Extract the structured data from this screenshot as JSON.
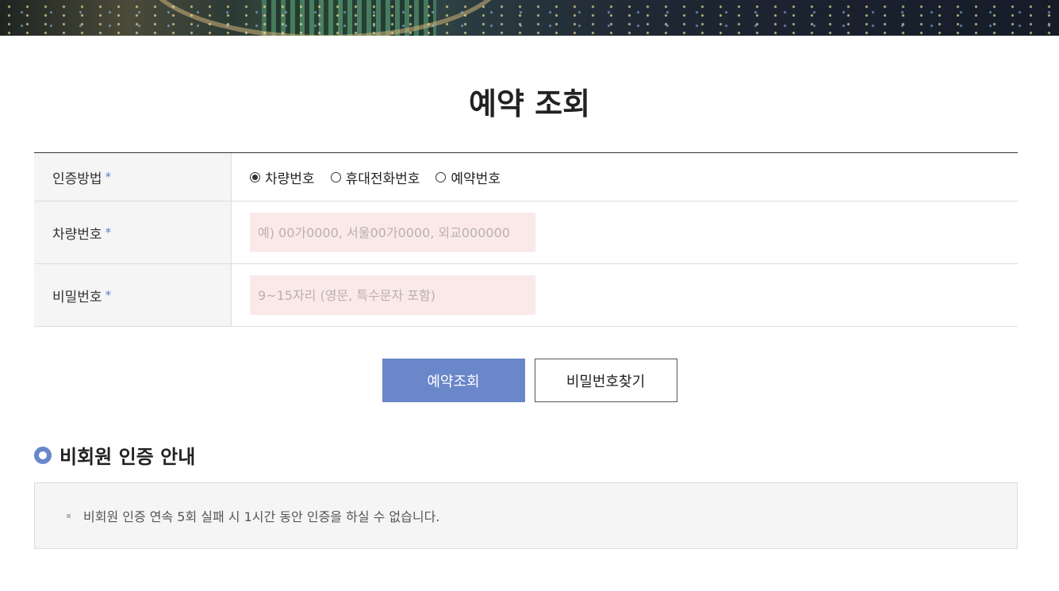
{
  "page": {
    "title": "예약 조회"
  },
  "form": {
    "auth_method": {
      "label": "인증방법",
      "required_mark": "*",
      "options": [
        {
          "label": "차량번호",
          "checked": true
        },
        {
          "label": "휴대전화번호",
          "checked": false
        },
        {
          "label": "예약번호",
          "checked": false
        }
      ]
    },
    "car_number": {
      "label": "차량번호",
      "required_mark": "*",
      "value": "",
      "placeholder": "예) 00가0000, 서울00가0000, 외교000000"
    },
    "password": {
      "label": "비밀번호",
      "required_mark": "*",
      "value": "",
      "placeholder": "9~15자리 (영문, 특수문자 포함)"
    }
  },
  "buttons": {
    "search": "예약조회",
    "find_password": "비밀번호찾기"
  },
  "notice": {
    "heading": "비회원 인증 안내",
    "items": [
      "비회원 인증 연속 5회 실패 시 1시간 동안 인증을 하실 수 없습니다."
    ]
  },
  "colors": {
    "accent": "#6987c9",
    "input_background": "#fbe9e9",
    "required_mark": "#5b7fcc"
  }
}
